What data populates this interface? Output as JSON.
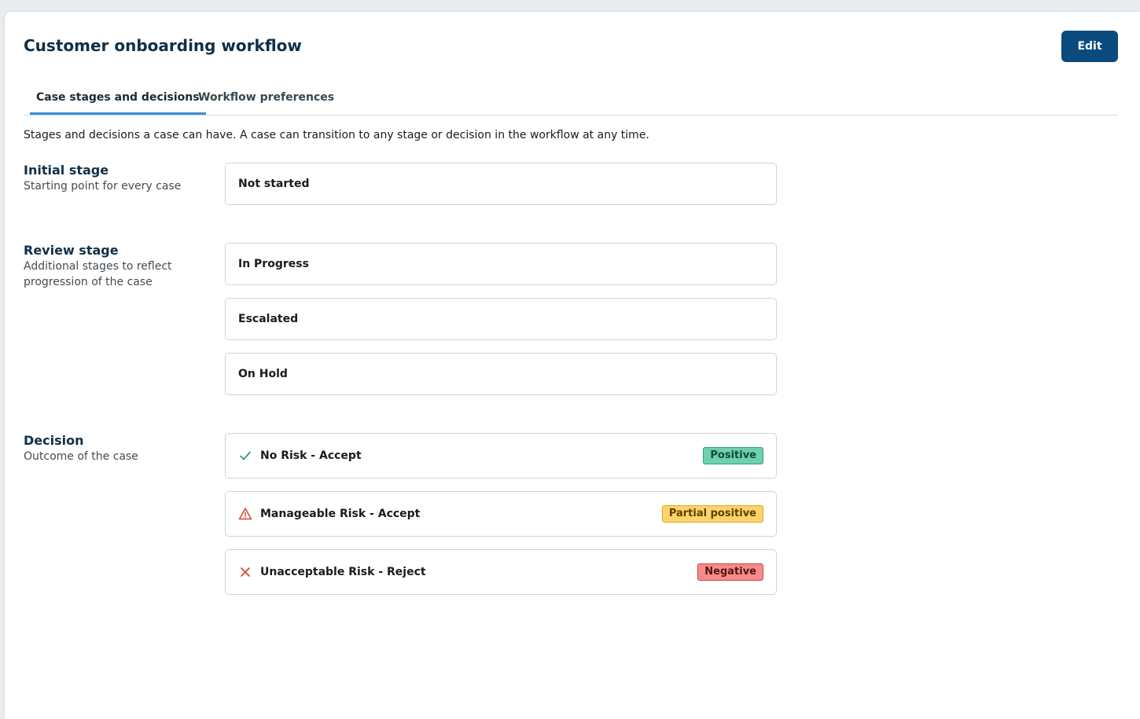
{
  "header": {
    "title": "Customer onboarding workflow",
    "edit_label": "Edit"
  },
  "tabs": [
    {
      "label": "Case stages and decisions",
      "active": true
    },
    {
      "label": "Workflow preferences",
      "active": false
    }
  ],
  "description": "Stages and decisions a case can have. A case can transition to any stage or decision in the workflow at any time.",
  "sections": {
    "initial": {
      "title": "Initial stage",
      "subtitle": "Starting point for every case",
      "items": [
        "Not started"
      ]
    },
    "review": {
      "title": "Review stage",
      "subtitle": "Additional stages to reflect progression of the case",
      "items": [
        "In Progress",
        "Escalated",
        "On Hold"
      ]
    },
    "decision": {
      "title": "Decision",
      "subtitle": "Outcome of the case",
      "items": [
        {
          "label": "No Risk - Accept",
          "icon": "check-icon",
          "badge": "Positive",
          "color": "#2f9d7a"
        },
        {
          "label": "Manageable Risk - Accept",
          "icon": "warning-icon",
          "badge": "Partial positive",
          "color": "#d4442e"
        },
        {
          "label": "Unacceptable Risk - Reject",
          "icon": "close-icon",
          "badge": "Negative",
          "color": "#d4442e"
        }
      ]
    }
  },
  "colors": {
    "primary": "#0b4a7d",
    "tab_indicator": "#3b8fd1",
    "positive": "#6fd0b0",
    "partial": "#ffd36b",
    "negative": "#f58b8b"
  }
}
